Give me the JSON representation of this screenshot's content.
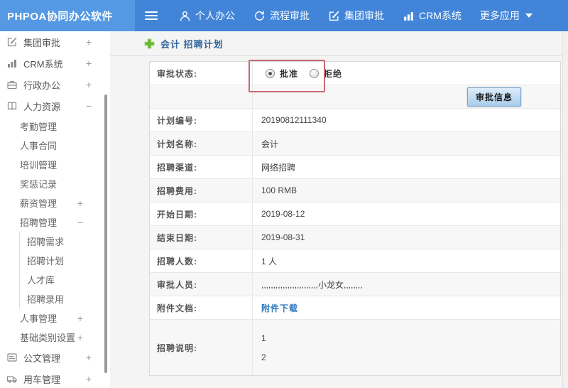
{
  "topbar": {
    "logo": "PHPOA协同办公软件",
    "nav": [
      {
        "label": "个人办公",
        "icon": "user-icon"
      },
      {
        "label": "流程审批",
        "icon": "process-icon"
      },
      {
        "label": "集团审批",
        "icon": "edit-square-icon"
      },
      {
        "label": "CRM系统",
        "icon": "bar-chart-icon"
      },
      {
        "label": "更多应用",
        "icon": "caret-down-icon"
      }
    ]
  },
  "sidebar": {
    "items": [
      {
        "label": "集团审批",
        "icon": "edit-square-icon",
        "toggle": "+",
        "level": 1
      },
      {
        "label": "CRM系统",
        "icon": "bar-chart-icon",
        "toggle": "+",
        "level": 1
      },
      {
        "label": "行政办公",
        "icon": "briefcase-icon",
        "toggle": "+",
        "level": 1
      },
      {
        "label": "人力资源",
        "icon": "book-icon",
        "toggle": "−",
        "level": 1
      },
      {
        "label": "考勤管理",
        "toggle": "",
        "level": 2
      },
      {
        "label": "人事合同",
        "toggle": "",
        "level": 2
      },
      {
        "label": "培训管理",
        "toggle": "",
        "level": 2
      },
      {
        "label": "奖惩记录",
        "toggle": "",
        "level": 2
      },
      {
        "label": "薪资管理",
        "toggle": "+",
        "level": 2
      },
      {
        "label": "招聘管理",
        "toggle": "−",
        "level": 2
      },
      {
        "label": "招聘需求",
        "toggle": "",
        "level": 3
      },
      {
        "label": "招聘计划",
        "toggle": "",
        "level": 3
      },
      {
        "label": "人才库",
        "toggle": "",
        "level": 3
      },
      {
        "label": "招聘录用",
        "toggle": "",
        "level": 3
      },
      {
        "label": "人事管理",
        "toggle": "+",
        "level": 2
      },
      {
        "label": "基础类别设置",
        "toggle": "+",
        "level": 2
      },
      {
        "label": "公文管理",
        "icon": "document-icon",
        "toggle": "+",
        "level": 1
      },
      {
        "label": "用车管理",
        "icon": "truck-icon",
        "toggle": "+",
        "level": 1
      }
    ]
  },
  "main": {
    "title": "会计 招聘计划",
    "form": {
      "status": {
        "label": "审批状态:",
        "options": [
          {
            "label": "批准",
            "selected": true
          },
          {
            "label": "拒绝",
            "selected": false
          }
        ]
      },
      "approve_info_button": "审批信息",
      "rows": [
        {
          "label": "计划编号:",
          "value": "20190812111340"
        },
        {
          "label": "计划名称:",
          "value": "会计"
        },
        {
          "label": "招聘渠道:",
          "value": "网络招聘"
        },
        {
          "label": "招聘费用:",
          "value": "100 RMB"
        },
        {
          "label": "开始日期:",
          "value": "2019-08-12"
        },
        {
          "label": "结束日期:",
          "value": "2019-08-31"
        },
        {
          "label": "招聘人数:",
          "value": "1 人"
        },
        {
          "label": "审批人员:",
          "value": ",,,,,,,,,,,,,,,,,,,,,,,,小龙女,,,,,,,,"
        }
      ],
      "attachment": {
        "label": "附件文档:",
        "link_text": "附件下载"
      },
      "description": {
        "label": "招聘说明:",
        "line1": "1",
        "line2": "2"
      }
    }
  },
  "colors": {
    "topbar_blue": "#4285d8",
    "logo_blue": "#5599e4",
    "title_blue": "#33669c",
    "link_blue": "#2e79c0",
    "plus_green": "#65b72f",
    "annotation_red": "#c66a72",
    "button_blue_top": "#ddecfb",
    "button_blue_bottom": "#a8cceb"
  }
}
